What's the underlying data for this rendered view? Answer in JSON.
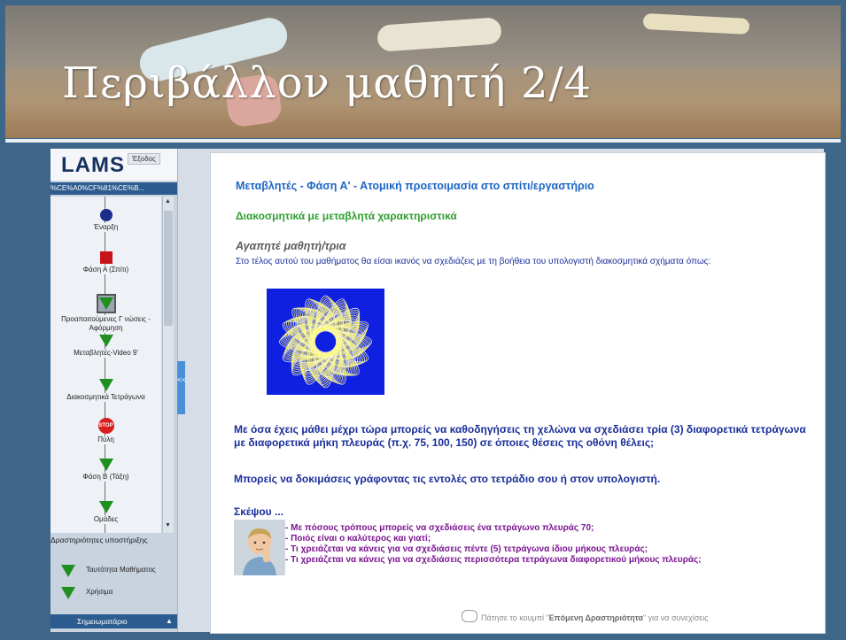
{
  "slide": {
    "title": "Περιβάλλον μαθητή 2/4"
  },
  "sidebar": {
    "logo": "LAMS",
    "exit_label": "Έξοδος",
    "course_id": "%CE%A0%CF%81%CE%B...",
    "nodes": [
      {
        "label": "Έναρξη",
        "shape": "circle"
      },
      {
        "label": "Φάση Α (Σπίτι)",
        "shape": "square"
      },
      {
        "label": "Προαπαιτούμενες Γ νώσεις - Αφόρμηση",
        "shape": "triangle-selected"
      },
      {
        "label": "Μεταβλητές-Video 9'",
        "shape": "triangle"
      },
      {
        "label": "Διακοσμητικά Τετράγωνα",
        "shape": "triangle"
      },
      {
        "label": "Πύλη",
        "shape": "stop-gate"
      },
      {
        "label": "Φάση Β (Τάξη)",
        "shape": "triangle"
      },
      {
        "label": "Ομάδες",
        "shape": "triangle"
      }
    ],
    "gate_text": "STOP",
    "support_header": "Δραστηριότητες υποστήριξης",
    "support_items": [
      "Ταυτότητα Μαθήματος",
      "Χρήσιμα"
    ],
    "notebook_label": "Σημειωματάριο",
    "collapse_arrows": "<<"
  },
  "content": {
    "title": "Μεταβλητές - Φάση Α' - Ατομική προετοιμασία στο σπίτι/εργαστήριο",
    "subtitle": "Διακοσμητικά με μεταβλητά χαρακτηριστικά",
    "greeting": "Αγαπητέ μαθητή/τρια",
    "intro": "Στο τέλος αυτού του μαθήματος θα είσαι ικανός να σχεδιάζεις με τη βοήθεια του υπολογιστή διακοσμητικά σχήματα όπως:",
    "task": "Με όσα έχεις μάθει μέχρι τώρα μπορείς να καθοδηγήσεις τη χελώνα να σχεδιάσει τρία (3) διαφορετικά τετράγωνα με διαφορετικά μήκη πλευράς (π.χ. 75, 100,  150) σε όποιες θέσεις της οθόνη θέλεις;",
    "try_prompt": "Μπορείς να δοκιμάσεις γράφοντας τις εντολές στο τετράδιο σου ή στον υπολογιστή.",
    "think_heading": "Σκέψου ...",
    "questions": [
      "- Με πόσους τρόπους μπορείς να σχεδιάσεις ένα τετράγωνο πλευράς 70;",
      "- Ποιός είναι ο καλύτερος και γιατί;",
      "- Τι χρειάζεται να κάνεις για να σχεδιάσεις πέντε (5) τετράγωνα ίδιου μήκους πλευράς;",
      "- Τι χρειάζεται να κάνεις για να σχεδιάσεις περισσότερα τετράγωνα διαφορετικού μήκους πλευράς;"
    ],
    "footer_pre": "Πάτησε το κουμπί \"",
    "footer_bold": "Επόμενη Δραστηριότητα",
    "footer_post": "\" για να συνεχίσεις"
  },
  "colors": {
    "background": "#3d6688",
    "title_blue": "#1e66c6",
    "subtitle_green": "#2f9e2f",
    "text_navy": "#1a2e9a",
    "question_purple": "#7a1490",
    "pattern_blue": "#1020e0",
    "pattern_yellow": "#f6ee20"
  }
}
